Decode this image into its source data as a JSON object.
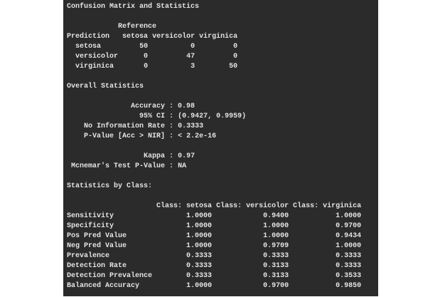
{
  "title": "Confusion Matrix and Statistics",
  "confusion": {
    "reference_label": "Reference",
    "prediction_label": "Prediction",
    "columns": [
      "setosa",
      "versicolor",
      "virginica"
    ],
    "rows": [
      {
        "label": "setosa",
        "values": [
          "50",
          "0",
          "0"
        ]
      },
      {
        "label": "versicolor",
        "values": [
          "0",
          "47",
          "0"
        ]
      },
      {
        "label": "virginica",
        "values": [
          "0",
          "3",
          "50"
        ]
      }
    ]
  },
  "overall": {
    "heading": "Overall Statistics",
    "group1": [
      {
        "label": "Accuracy",
        "value": "0.98"
      },
      {
        "label": "95% CI",
        "value": "(0.9427, 0.9959)"
      },
      {
        "label": "No Information Rate",
        "value": "0.3333"
      },
      {
        "label": "P-Value [Acc > NIR]",
        "value": "< 2.2e-16"
      }
    ],
    "group2": [
      {
        "label": "Kappa",
        "value": "0.97"
      },
      {
        "label": "Mcnemar's Test P-Value",
        "value": "NA"
      }
    ]
  },
  "by_class": {
    "heading": "Statistics by Class:",
    "columns": [
      "Class: setosa",
      "Class: versicolor",
      "Class: virginica"
    ],
    "rows": [
      {
        "label": "Sensitivity",
        "values": [
          "1.0000",
          "0.9400",
          "1.0000"
        ]
      },
      {
        "label": "Specificity",
        "values": [
          "1.0000",
          "1.0000",
          "0.9700"
        ]
      },
      {
        "label": "Pos Pred Value",
        "values": [
          "1.0000",
          "1.0000",
          "0.9434"
        ]
      },
      {
        "label": "Neg Pred Value",
        "values": [
          "1.0000",
          "0.9709",
          "1.0000"
        ]
      },
      {
        "label": "Prevalence",
        "values": [
          "0.3333",
          "0.3333",
          "0.3333"
        ]
      },
      {
        "label": "Detection Rate",
        "values": [
          "0.3333",
          "0.3133",
          "0.3333"
        ]
      },
      {
        "label": "Detection Prevalence",
        "values": [
          "0.3333",
          "0.3133",
          "0.3533"
        ]
      },
      {
        "label": "Balanced Accuracy",
        "values": [
          "1.0000",
          "0.9700",
          "0.9850"
        ]
      }
    ]
  }
}
